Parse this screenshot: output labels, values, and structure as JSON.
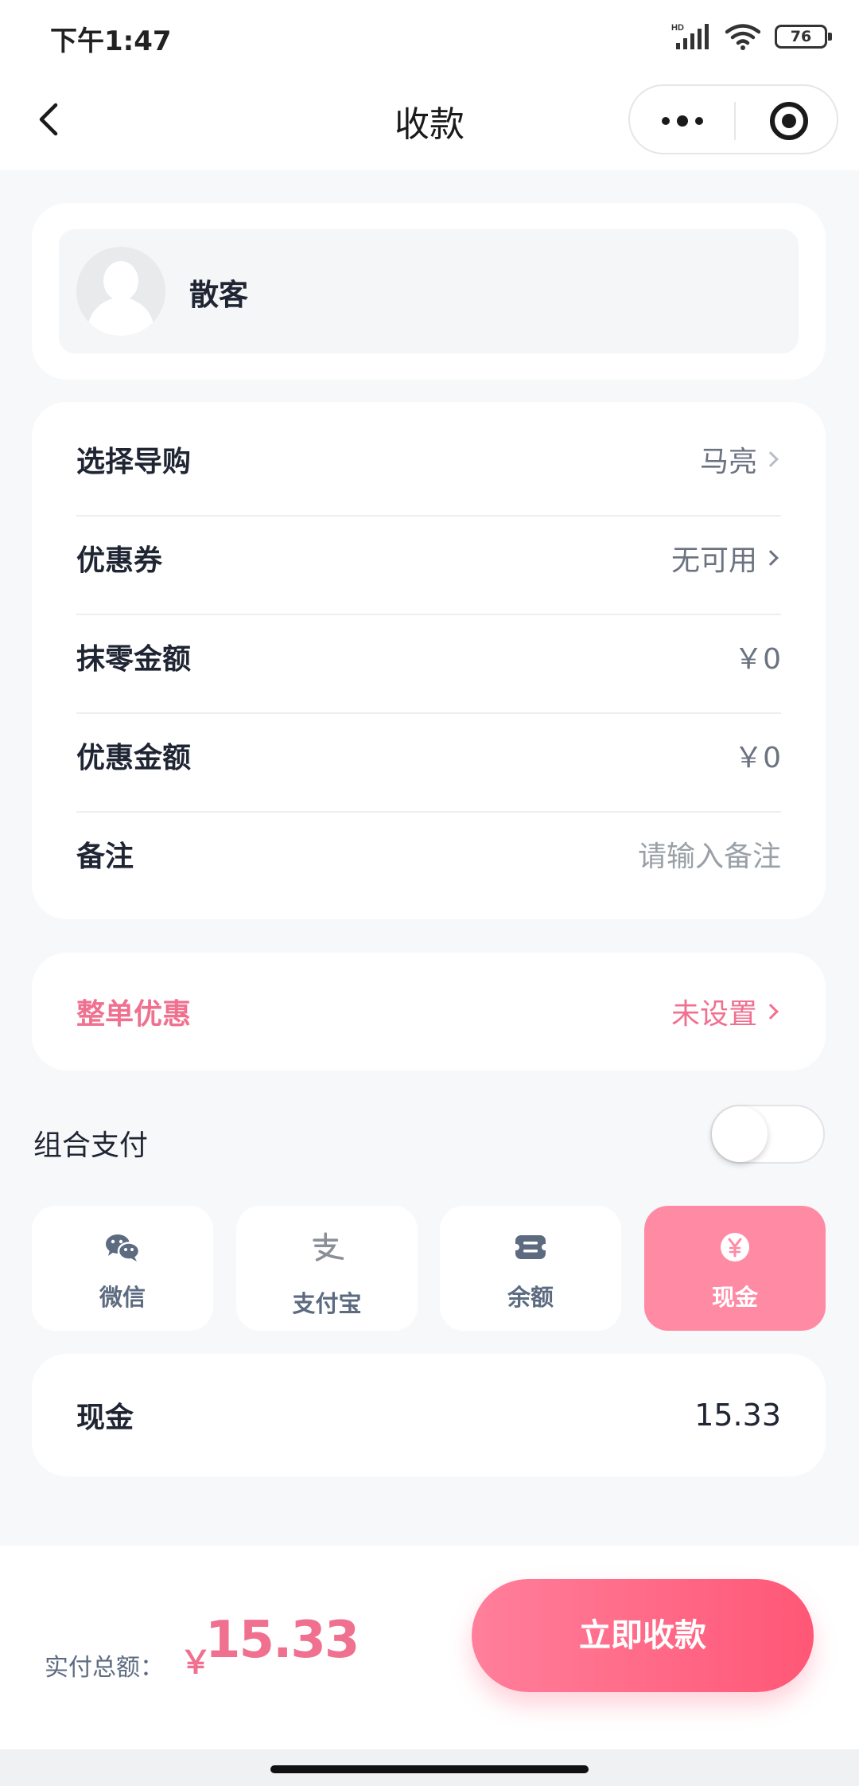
{
  "status_bar": {
    "time": "下午1:47",
    "battery": "76"
  },
  "nav": {
    "title": "收款"
  },
  "customer": {
    "name": "散客"
  },
  "info_rows": [
    {
      "label": "选择导购",
      "value": "马亮"
    },
    {
      "label": "优惠券",
      "value": "无可用"
    },
    {
      "label": "抹零金额",
      "value": "￥0"
    },
    {
      "label": "优惠金额",
      "value": "￥0"
    },
    {
      "label": "备注",
      "placeholder": "请输入备注"
    }
  ],
  "whole_discount": {
    "label": "整单优惠",
    "value": "未设置"
  },
  "combo_pay": {
    "label": "组合支付",
    "enabled": false
  },
  "pay_methods": [
    {
      "label": "微信",
      "icon": "wechat-icon",
      "selected": false
    },
    {
      "label": "支付宝",
      "icon": "alipay-icon",
      "selected": false
    },
    {
      "label": "余额",
      "icon": "wallet-icon",
      "selected": false
    },
    {
      "label": "现金",
      "icon": "yuan-coin-icon",
      "selected": true
    }
  ],
  "cash": {
    "label": "现金",
    "value": "15.33"
  },
  "footer": {
    "total_label": "实付总额：",
    "currency": "￥",
    "total": "15.33",
    "submit": "立即收款"
  },
  "colors": {
    "accent": "#f0708f",
    "active_pay": "#ff8aa4",
    "button_start": "#ff7f9b",
    "button_end": "#ff5776"
  }
}
